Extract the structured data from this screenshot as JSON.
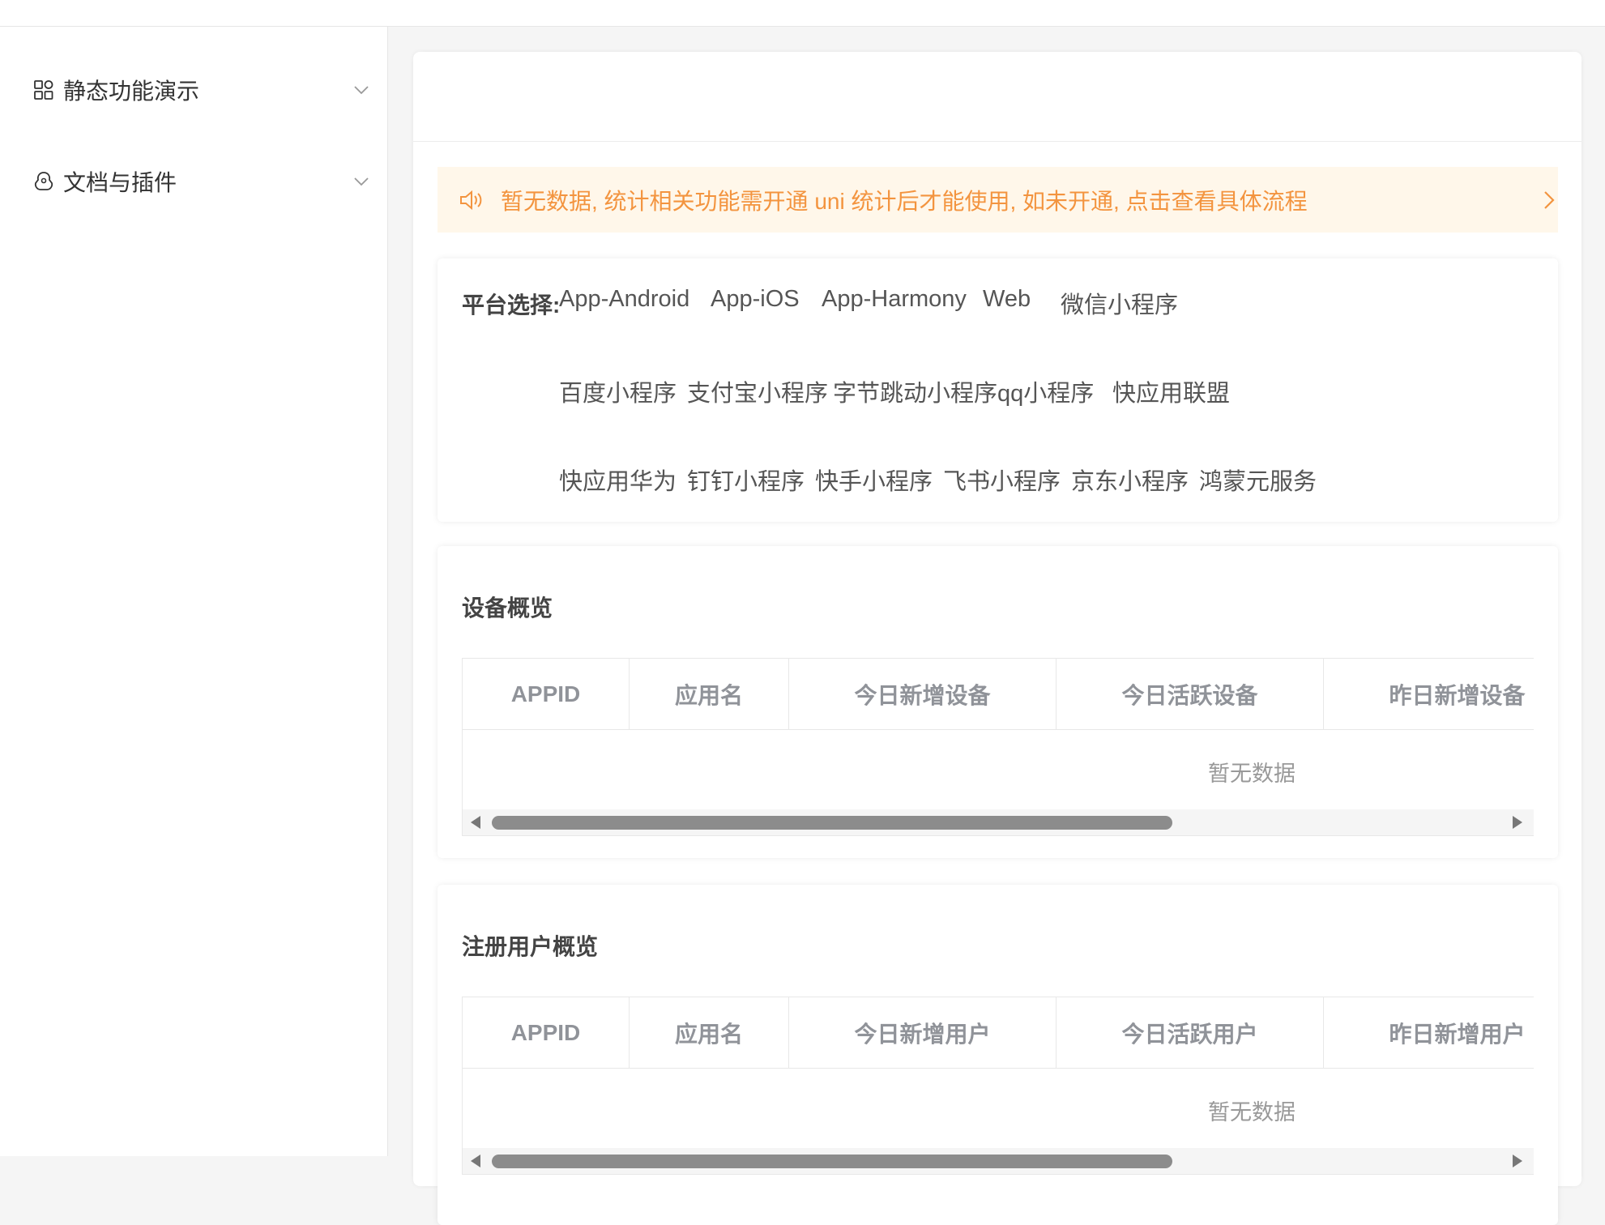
{
  "sidebar": {
    "items": [
      {
        "label": "静态功能演示",
        "icon": "grid-icon"
      },
      {
        "label": "文档与插件",
        "icon": "plugin-icon"
      }
    ]
  },
  "notice": {
    "text": "暂无数据, 统计相关功能需开通 uni 统计后才能使用, 如未开通, 点击查看具体流程",
    "color": "#f3943f",
    "background": "#fff7ea"
  },
  "platform": {
    "title": "平台选择:",
    "options": [
      "App-Android",
      "App-iOS",
      "App-Harmony",
      "Web",
      "微信小程序",
      "百度小程序",
      "支付宝小程序",
      "字节跳动小程序",
      "qq小程序",
      "快应用联盟",
      "快应用华为",
      "钉钉小程序",
      "快手小程序",
      "飞书小程序",
      "京东小程序",
      "鸿蒙元服务"
    ]
  },
  "device_overview": {
    "title": "设备概览",
    "columns": [
      "APPID",
      "应用名",
      "今日新增设备",
      "今日活跃设备",
      "昨日新增设备"
    ],
    "empty_text": "暂无数据"
  },
  "user_overview": {
    "title": "注册用户概览",
    "columns": [
      "APPID",
      "应用名",
      "今日新增用户",
      "今日活跃用户",
      "昨日新增用户"
    ],
    "empty_text": "暂无数据"
  }
}
